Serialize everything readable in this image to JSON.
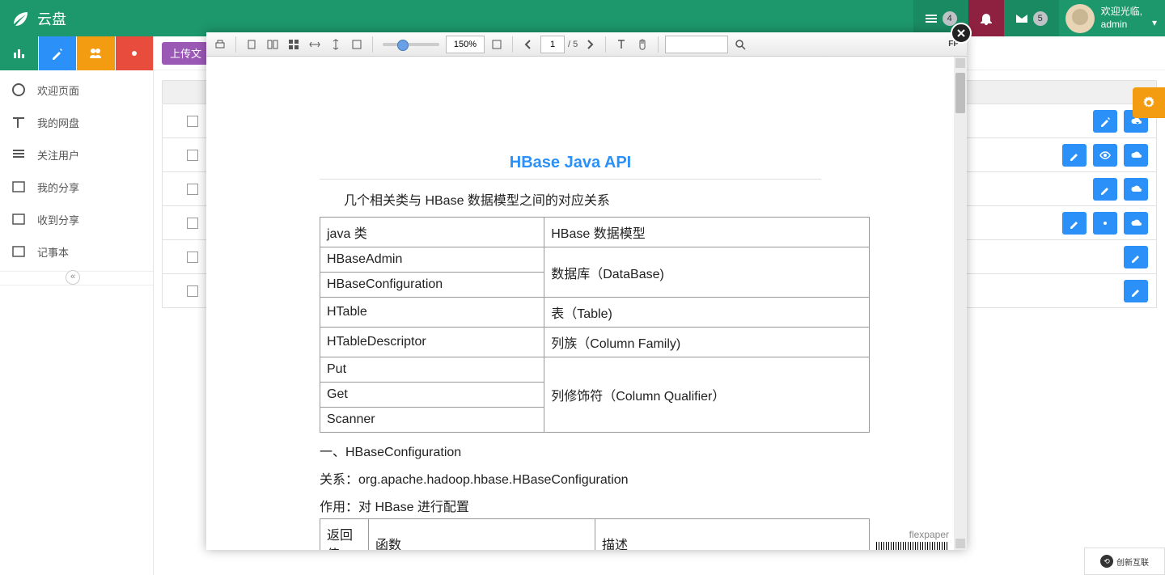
{
  "header": {
    "app_name": "云盘",
    "badge_menu": "4",
    "badge_mail": "5",
    "welcome": "欢迎光临,",
    "username": "admin"
  },
  "sidebar": {
    "items": [
      {
        "label": "欢迎页面"
      },
      {
        "label": "我的网盘"
      },
      {
        "label": "关注用户"
      },
      {
        "label": "我的分享"
      },
      {
        "label": "收到分享"
      },
      {
        "label": "记事本"
      }
    ]
  },
  "content": {
    "upload_btn_partial": "上传文"
  },
  "pdf": {
    "zoom": "150%",
    "page": "1",
    "page_total": "/  5",
    "fp": "FP",
    "mark": "flexpaper"
  },
  "document": {
    "title": "HBase Java API",
    "subtitle": "几个相关类与 HBase 数据模型之间的对应关系",
    "rows": [
      {
        "left": "java 类",
        "right": "HBase 数据模型"
      },
      {
        "left": "HBaseAdmin",
        "right_rowspan": "数据库（DataBase)"
      },
      {
        "left": "HBaseConfiguration"
      },
      {
        "left": "HTable",
        "right": "表（Table)"
      },
      {
        "left": "HTableDescriptor",
        "right": "列族（Column Family)"
      },
      {
        "left": "Put",
        "right_rowspan": "列修饰符（Column Qualifier）"
      },
      {
        "left": "Get"
      },
      {
        "left": "Scanner"
      }
    ],
    "p1": "一、HBaseConfiguration",
    "p2": "关系：org.apache.hadoop.hbase.HBaseConfiguration",
    "p3": "作用：对 HBase 进行配置",
    "t2": {
      "c1": "返回值",
      "c2": "函数",
      "c3": "描述"
    }
  },
  "partner": {
    "label": "创新互联"
  }
}
